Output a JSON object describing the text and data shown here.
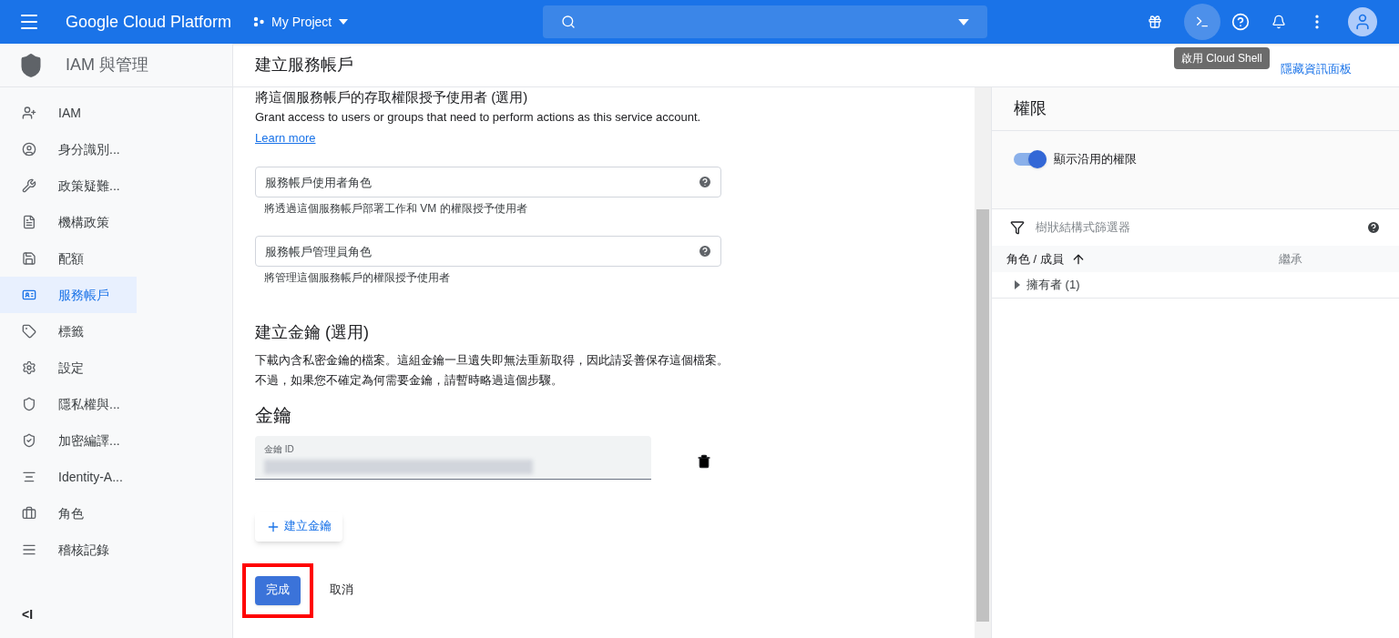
{
  "topbar": {
    "brand": "Google Cloud Platform",
    "project": "My Project",
    "tooltip": "啟用 Cloud Shell"
  },
  "sidebar": {
    "title": "IAM 與管理",
    "items": [
      {
        "label": "IAM",
        "selected": false
      },
      {
        "label": "身分識別...",
        "selected": false
      },
      {
        "label": "政策疑難...",
        "selected": false
      },
      {
        "label": "機構政策",
        "selected": false
      },
      {
        "label": "配額",
        "selected": false
      },
      {
        "label": "服務帳戶",
        "selected": true
      },
      {
        "label": "標籤",
        "selected": false
      },
      {
        "label": "設定",
        "selected": false
      },
      {
        "label": "隱私權與...",
        "selected": false
      },
      {
        "label": "加密編譯...",
        "selected": false
      },
      {
        "label": "Identity-A...",
        "selected": false
      },
      {
        "label": "角色",
        "selected": false
      },
      {
        "label": "稽核記錄",
        "selected": false
      }
    ],
    "collapse": "<I"
  },
  "page": {
    "title": "建立服務帳戶",
    "hide_panel_link": "隱藏資訊面板"
  },
  "form": {
    "section_heading": "將這個服務帳戶的存取權限授予使用者 (選用)",
    "description": "Grant access to users or groups that need to perform actions as this service account.",
    "learn_more": "Learn more",
    "role_fields": [
      {
        "placeholder": "服務帳戶使用者角色",
        "hint": "將透過這個服務帳戶部署工作和 VM 的權限授予使用者"
      },
      {
        "placeholder": "服務帳戶管理員角色",
        "hint": "將管理這個服務帳戶的權限授予使用者"
      }
    ],
    "key_heading": "建立金鑰 (選用)",
    "key_description": [
      "下載內含私密金鑰的檔案。這組金鑰一旦遺失即無法重新取得，因此請妥善保存這個檔案。",
      "不過，如果您不確定為何需要金鑰，請暫時略過這個步驟。"
    ],
    "keys_title": "金鑰",
    "key_field_label": "金鑰 ID",
    "create_key_button": "建立金鑰",
    "done_button": "完成",
    "cancel_button": "取消"
  },
  "panel": {
    "title": "權限",
    "toggle": {
      "label": "顯示沿用的權限",
      "on": true
    },
    "filter_placeholder": "樹狀結構式篩選器",
    "columns": [
      "角色 / 成員",
      "繼承"
    ],
    "rows": [
      {
        "label": "擁有者 (1)",
        "expanded": false
      }
    ]
  }
}
